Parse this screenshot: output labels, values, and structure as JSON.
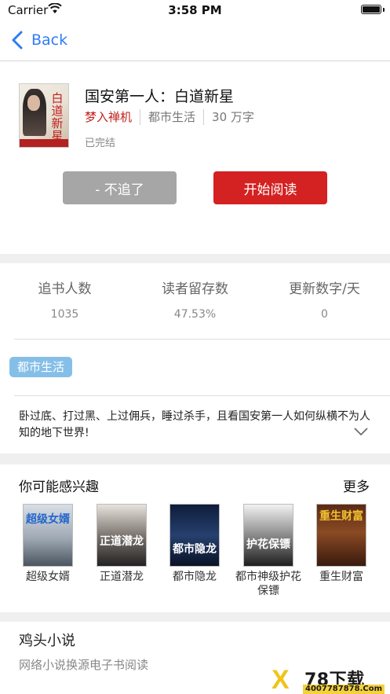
{
  "status_bar": {
    "carrier": "Carrier",
    "time": "3:58 PM"
  },
  "nav": {
    "back_label": "Back"
  },
  "book": {
    "title": "国安第一人：白道新星",
    "author": "梦入禅机",
    "genre": "都市生活",
    "word_count": "30 万字",
    "status": "已完结",
    "cover_text": "白道新星",
    "unfollow_label": "- 不追了",
    "read_label": "开始阅读"
  },
  "stats": [
    {
      "label": "追书人数",
      "value": "1035"
    },
    {
      "label": "读者留存数",
      "value": "47.53%"
    },
    {
      "label": "更新数字/天",
      "value": "0"
    }
  ],
  "tags": [
    "都市生活"
  ],
  "description": "卧过底、打过黑、上过佣兵，睡过杀手，且看国安第一人如何纵横不为人知的地下世界!",
  "recommendations": {
    "title": "你可能感兴趣",
    "more_label": "更多",
    "items": [
      {
        "title": "超级女婿",
        "cover_text": "超级女婿"
      },
      {
        "title": "正道潜龙",
        "cover_text": "正道潜龙"
      },
      {
        "title": "都市隐龙",
        "cover_text": "都市隐龙"
      },
      {
        "title": "都市神级护花保镖",
        "cover_text": "护花保镖"
      },
      {
        "title": "重生财富",
        "cover_text": "重生财富"
      }
    ]
  },
  "app": {
    "name": "鸡头小说",
    "tagline": "网络小说换源电子书阅读"
  },
  "watermark": {
    "brand": "78下载",
    "url": "4007787878.Com"
  },
  "colors": {
    "accent_blue": "#2f7cf6",
    "read_red": "#d42121",
    "author_red": "#c0211c",
    "tag_blue": "#85bfe8",
    "unfollow_gray": "#a6a6a6"
  }
}
